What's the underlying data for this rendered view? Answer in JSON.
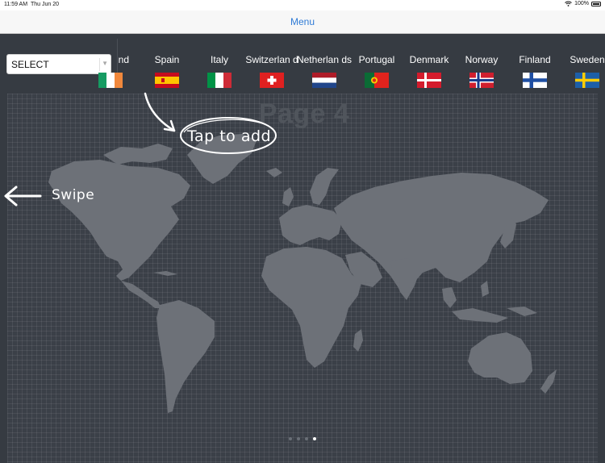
{
  "status_bar": {
    "time": "11:59 AM",
    "date": "Thu Jun 20",
    "battery": "100%"
  },
  "nav": {
    "title": "Menu"
  },
  "select": {
    "value": "SELECT"
  },
  "page": {
    "title": "Page 4",
    "total_pages": 4,
    "current_page": 4
  },
  "flags": [
    {
      "name": "Ireland",
      "visible_name": "nd",
      "icon": "ireland-flag"
    },
    {
      "name": "Spain",
      "icon": "spain-flag"
    },
    {
      "name": "Italy",
      "icon": "italy-flag"
    },
    {
      "name": "Switzerland",
      "visible_name": "Switzerlan d",
      "icon": "switzerland-flag"
    },
    {
      "name": "Netherlands",
      "visible_name": "Netherlan ds",
      "icon": "netherlands-flag"
    },
    {
      "name": "Portugal",
      "icon": "portugal-flag"
    },
    {
      "name": "Denmark",
      "icon": "denmark-flag"
    },
    {
      "name": "Norway",
      "icon": "norway-flag"
    },
    {
      "name": "Finland",
      "icon": "finland-flag"
    },
    {
      "name": "Sweden",
      "icon": "sweden-flag"
    }
  ],
  "hints": {
    "tap": "Tap to add",
    "swipe": "Swipe"
  },
  "colors": {
    "background": "#363b42",
    "land": "#6d7178",
    "accent": "#2f7bd6"
  }
}
